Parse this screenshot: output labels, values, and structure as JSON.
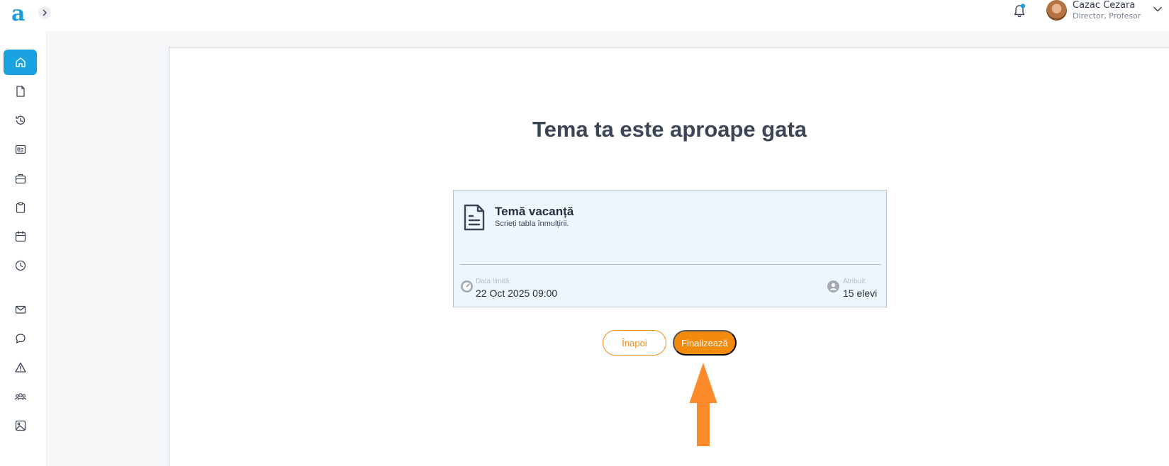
{
  "app": {
    "logo_letter": "a",
    "accent_color": "#1aa1e0",
    "primary_action_color": "#f28a0c"
  },
  "header": {
    "notifications_icon": "bell-icon",
    "user": {
      "name": "Cazac Cezara",
      "role": "Director, Profesor"
    }
  },
  "sidebar": {
    "items": [
      {
        "name": "home",
        "icon": "home-icon",
        "active": true
      },
      {
        "name": "documents",
        "icon": "document-icon",
        "active": false
      },
      {
        "name": "history",
        "icon": "history-icon",
        "active": false
      },
      {
        "name": "catalog",
        "icon": "catalog-icon",
        "active": false
      },
      {
        "name": "portfolio",
        "icon": "briefcase-icon",
        "active": false
      },
      {
        "name": "tasks",
        "icon": "clipboard-icon",
        "active": false
      },
      {
        "name": "calendar",
        "icon": "calendar-icon",
        "active": false
      },
      {
        "name": "schedule",
        "icon": "clock-icon",
        "active": false
      },
      {
        "name": "messages",
        "icon": "mail-icon",
        "active": false
      },
      {
        "name": "chat",
        "icon": "chat-icon",
        "active": false
      },
      {
        "name": "alerts",
        "icon": "warning-icon",
        "active": false
      },
      {
        "name": "groups",
        "icon": "users-icon",
        "active": false
      },
      {
        "name": "gallery",
        "icon": "image-icon",
        "active": false
      }
    ]
  },
  "main": {
    "heading": "Tema ta este aproape gata",
    "card": {
      "title": "Temă vacanță",
      "description": "Scrieți tabla înmulțirii.",
      "due_label": "Data limită:",
      "due_value": "22 Oct 2025 09:00",
      "assigned_label": "Atribuit:",
      "assigned_value": "15 elevi"
    },
    "buttons": {
      "back": "Înapoi",
      "finish": "Finalizează"
    }
  }
}
